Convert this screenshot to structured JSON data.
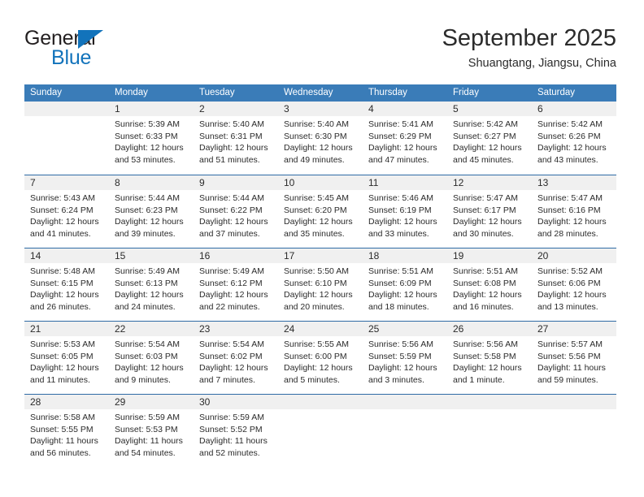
{
  "brand": {
    "word_general": "General",
    "word_blue": "Blue",
    "triangle_color": "#1273bb"
  },
  "header": {
    "title": "September 2025",
    "subtitle": "Shuangtang, Jiangsu, China"
  },
  "theme": {
    "header_bar_color": "#3a7cb8",
    "daynum_band_color": "#f0f0f0",
    "week_separator_color": "#2f6ba5",
    "text_color": "#2b2b2b"
  },
  "weekday_headers": [
    "Sunday",
    "Monday",
    "Tuesday",
    "Wednesday",
    "Thursday",
    "Friday",
    "Saturday"
  ],
  "weeks": [
    [
      {
        "day": "",
        "lines": []
      },
      {
        "day": "1",
        "lines": [
          "Sunrise: 5:39 AM",
          "Sunset: 6:33 PM",
          "Daylight: 12 hours",
          "and 53 minutes."
        ]
      },
      {
        "day": "2",
        "lines": [
          "Sunrise: 5:40 AM",
          "Sunset: 6:31 PM",
          "Daylight: 12 hours",
          "and 51 minutes."
        ]
      },
      {
        "day": "3",
        "lines": [
          "Sunrise: 5:40 AM",
          "Sunset: 6:30 PM",
          "Daylight: 12 hours",
          "and 49 minutes."
        ]
      },
      {
        "day": "4",
        "lines": [
          "Sunrise: 5:41 AM",
          "Sunset: 6:29 PM",
          "Daylight: 12 hours",
          "and 47 minutes."
        ]
      },
      {
        "day": "5",
        "lines": [
          "Sunrise: 5:42 AM",
          "Sunset: 6:27 PM",
          "Daylight: 12 hours",
          "and 45 minutes."
        ]
      },
      {
        "day": "6",
        "lines": [
          "Sunrise: 5:42 AM",
          "Sunset: 6:26 PM",
          "Daylight: 12 hours",
          "and 43 minutes."
        ]
      }
    ],
    [
      {
        "day": "7",
        "lines": [
          "Sunrise: 5:43 AM",
          "Sunset: 6:24 PM",
          "Daylight: 12 hours",
          "and 41 minutes."
        ]
      },
      {
        "day": "8",
        "lines": [
          "Sunrise: 5:44 AM",
          "Sunset: 6:23 PM",
          "Daylight: 12 hours",
          "and 39 minutes."
        ]
      },
      {
        "day": "9",
        "lines": [
          "Sunrise: 5:44 AM",
          "Sunset: 6:22 PM",
          "Daylight: 12 hours",
          "and 37 minutes."
        ]
      },
      {
        "day": "10",
        "lines": [
          "Sunrise: 5:45 AM",
          "Sunset: 6:20 PM",
          "Daylight: 12 hours",
          "and 35 minutes."
        ]
      },
      {
        "day": "11",
        "lines": [
          "Sunrise: 5:46 AM",
          "Sunset: 6:19 PM",
          "Daylight: 12 hours",
          "and 33 minutes."
        ]
      },
      {
        "day": "12",
        "lines": [
          "Sunrise: 5:47 AM",
          "Sunset: 6:17 PM",
          "Daylight: 12 hours",
          "and 30 minutes."
        ]
      },
      {
        "day": "13",
        "lines": [
          "Sunrise: 5:47 AM",
          "Sunset: 6:16 PM",
          "Daylight: 12 hours",
          "and 28 minutes."
        ]
      }
    ],
    [
      {
        "day": "14",
        "lines": [
          "Sunrise: 5:48 AM",
          "Sunset: 6:15 PM",
          "Daylight: 12 hours",
          "and 26 minutes."
        ]
      },
      {
        "day": "15",
        "lines": [
          "Sunrise: 5:49 AM",
          "Sunset: 6:13 PM",
          "Daylight: 12 hours",
          "and 24 minutes."
        ]
      },
      {
        "day": "16",
        "lines": [
          "Sunrise: 5:49 AM",
          "Sunset: 6:12 PM",
          "Daylight: 12 hours",
          "and 22 minutes."
        ]
      },
      {
        "day": "17",
        "lines": [
          "Sunrise: 5:50 AM",
          "Sunset: 6:10 PM",
          "Daylight: 12 hours",
          "and 20 minutes."
        ]
      },
      {
        "day": "18",
        "lines": [
          "Sunrise: 5:51 AM",
          "Sunset: 6:09 PM",
          "Daylight: 12 hours",
          "and 18 minutes."
        ]
      },
      {
        "day": "19",
        "lines": [
          "Sunrise: 5:51 AM",
          "Sunset: 6:08 PM",
          "Daylight: 12 hours",
          "and 16 minutes."
        ]
      },
      {
        "day": "20",
        "lines": [
          "Sunrise: 5:52 AM",
          "Sunset: 6:06 PM",
          "Daylight: 12 hours",
          "and 13 minutes."
        ]
      }
    ],
    [
      {
        "day": "21",
        "lines": [
          "Sunrise: 5:53 AM",
          "Sunset: 6:05 PM",
          "Daylight: 12 hours",
          "and 11 minutes."
        ]
      },
      {
        "day": "22",
        "lines": [
          "Sunrise: 5:54 AM",
          "Sunset: 6:03 PM",
          "Daylight: 12 hours",
          "and 9 minutes."
        ]
      },
      {
        "day": "23",
        "lines": [
          "Sunrise: 5:54 AM",
          "Sunset: 6:02 PM",
          "Daylight: 12 hours",
          "and 7 minutes."
        ]
      },
      {
        "day": "24",
        "lines": [
          "Sunrise: 5:55 AM",
          "Sunset: 6:00 PM",
          "Daylight: 12 hours",
          "and 5 minutes."
        ]
      },
      {
        "day": "25",
        "lines": [
          "Sunrise: 5:56 AM",
          "Sunset: 5:59 PM",
          "Daylight: 12 hours",
          "and 3 minutes."
        ]
      },
      {
        "day": "26",
        "lines": [
          "Sunrise: 5:56 AM",
          "Sunset: 5:58 PM",
          "Daylight: 12 hours",
          "and 1 minute."
        ]
      },
      {
        "day": "27",
        "lines": [
          "Sunrise: 5:57 AM",
          "Sunset: 5:56 PM",
          "Daylight: 11 hours",
          "and 59 minutes."
        ]
      }
    ],
    [
      {
        "day": "28",
        "lines": [
          "Sunrise: 5:58 AM",
          "Sunset: 5:55 PM",
          "Daylight: 11 hours",
          "and 56 minutes."
        ]
      },
      {
        "day": "29",
        "lines": [
          "Sunrise: 5:59 AM",
          "Sunset: 5:53 PM",
          "Daylight: 11 hours",
          "and 54 minutes."
        ]
      },
      {
        "day": "30",
        "lines": [
          "Sunrise: 5:59 AM",
          "Sunset: 5:52 PM",
          "Daylight: 11 hours",
          "and 52 minutes."
        ]
      },
      {
        "day": "",
        "lines": []
      },
      {
        "day": "",
        "lines": []
      },
      {
        "day": "",
        "lines": []
      },
      {
        "day": "",
        "lines": []
      }
    ]
  ]
}
